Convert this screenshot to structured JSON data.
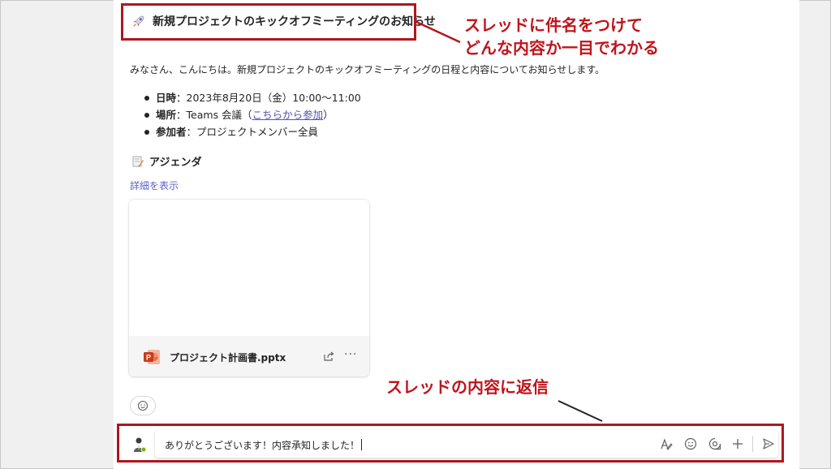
{
  "thread": {
    "title": "新規プロジェクトのキックオフミーティングのお知らせ",
    "intro": "みなさん、こんにちは。新規プロジェクトのキックオフミーティングの日程と内容についてお知らせします。",
    "details": [
      {
        "label": "日時",
        "sep": "：",
        "value": "2023年8月20日（金）10:00〜11:00"
      },
      {
        "label": "場所",
        "sep": "：",
        "value": "Teams 会議（",
        "link": "こちらから参加",
        "after": "）"
      },
      {
        "label": "参加者",
        "sep": "：",
        "value": "プロジェクトメンバー全員"
      }
    ],
    "agenda_label": "アジェンダ",
    "show_details": "詳細を表示"
  },
  "attachment": {
    "file_name": "プロジェクト計画書.pptx",
    "more": "···"
  },
  "reply": {
    "text": "ありがとうございます！内容承知しました！"
  },
  "annotations": {
    "title_note_line1": "スレッドに件名をつけて",
    "title_note_line2": "どんな内容か一目でわかる",
    "reply_note": "スレッドの内容に返信"
  },
  "colors": {
    "annotation": "#c0141c",
    "link": "#4f52b2",
    "ppt": "#c43e1c"
  },
  "icons": [
    "rocket-icon",
    "memo-icon",
    "powerpoint-icon",
    "share-icon",
    "more-icon",
    "reaction-icon",
    "avatar-icon",
    "format-icon",
    "emoji-icon",
    "loop-icon",
    "plus-icon",
    "send-icon"
  ]
}
